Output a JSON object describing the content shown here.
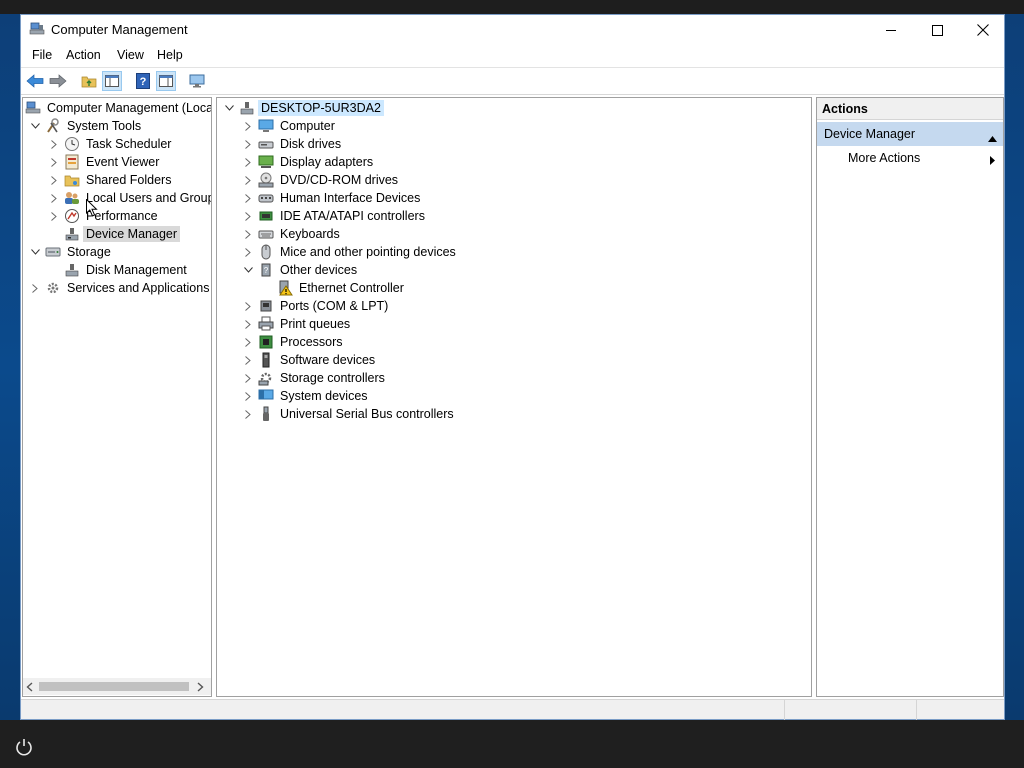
{
  "window": {
    "title": "Computer Management"
  },
  "menu": {
    "items": [
      "File",
      "Action",
      "View",
      "Help"
    ]
  },
  "toolbar": {
    "buttons": [
      "back-arrow-icon",
      "forward-arrow-icon",
      "up-folder-icon",
      "show-hide-tree-icon",
      "help-icon",
      "show-hide-action-pane-icon",
      "monitor-icon"
    ]
  },
  "left_tree": {
    "root": "Computer Management (Local",
    "system_tools": "System Tools",
    "task_scheduler": "Task Scheduler",
    "event_viewer": "Event Viewer",
    "shared_folders": "Shared Folders",
    "local_users": "Local Users and Groups",
    "performance": "Performance",
    "device_manager": "Device Manager",
    "storage": "Storage",
    "disk_management": "Disk Management",
    "services": "Services and Applications"
  },
  "device_tree": {
    "host": "DESKTOP-5UR3DA2",
    "items": [
      "Computer",
      "Disk drives",
      "Display adapters",
      "DVD/CD-ROM drives",
      "Human Interface Devices",
      "IDE ATA/ATAPI controllers",
      "Keyboards",
      "Mice and other pointing devices",
      "Other devices",
      "Ethernet Controller",
      "Ports (COM & LPT)",
      "Print queues",
      "Processors",
      "Software devices",
      "Storage controllers",
      "System devices",
      "Universal Serial Bus controllers"
    ]
  },
  "actions": {
    "header": "Actions",
    "section": "Device Manager",
    "more": "More Actions"
  },
  "colors": {
    "selection_gray": "#d9d9d9",
    "selection_blue": "#cce8ff",
    "actions_section": "#c5d9ef"
  }
}
